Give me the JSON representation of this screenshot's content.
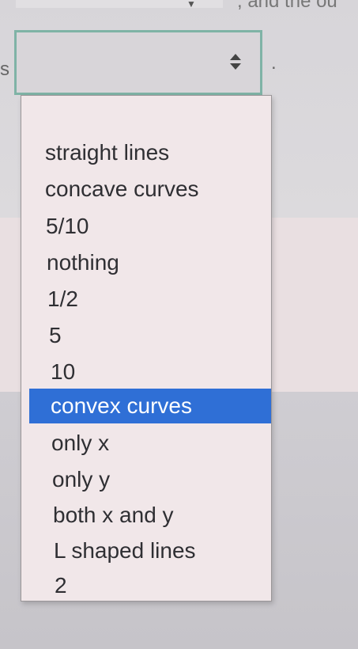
{
  "page": {
    "left_fragment": "s",
    "trailing_punct": ".",
    "prev_row_text": ", and the ou"
  },
  "select": {
    "selected_value": "",
    "arrow_icon": "up-down-chevron-icon",
    "border_color": "#7fb3a6"
  },
  "dropdown": {
    "highlight_color": "#2f6fd6",
    "options": [
      {
        "label": ""
      },
      {
        "label": "straight lines"
      },
      {
        "label": "concave curves"
      },
      {
        "label": "5/10"
      },
      {
        "label": "nothing"
      },
      {
        "label": "1/2"
      },
      {
        "label": "5"
      },
      {
        "label": "10"
      },
      {
        "label": "convex curves",
        "highlighted": true
      },
      {
        "label": "only x"
      },
      {
        "label": "only y"
      },
      {
        "label": "both x and y"
      },
      {
        "label": "L shaped lines"
      },
      {
        "label": "2"
      }
    ]
  }
}
